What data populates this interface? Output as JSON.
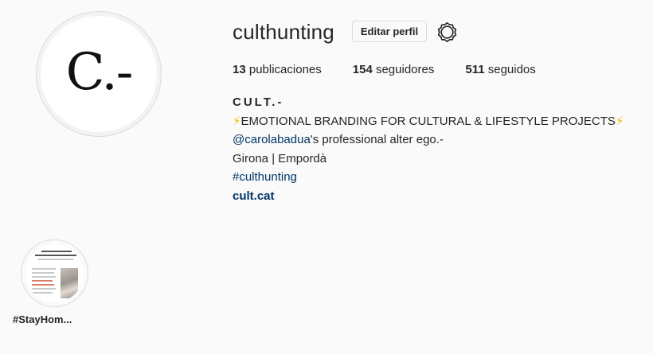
{
  "profile": {
    "avatar_text": "C.-",
    "username": "culthunting",
    "edit_button_label": "Editar perfil",
    "settings_icon": "gear-icon"
  },
  "stats": {
    "posts_count": "13",
    "posts_label": "publicaciones",
    "followers_count": "154",
    "followers_label": "seguidores",
    "following_count": "511",
    "following_label": "seguidos"
  },
  "bio": {
    "name": "CULT.-",
    "bolt": "⚡",
    "tagline": "EMOTIONAL BRANDING FOR CULTURAL & LIFESTYLE PROJECTS",
    "mention": "@carolabadua",
    "mention_suffix": "'s professional alter ego.-",
    "location": "Girona | Empordà",
    "hashtag": "#culthunting",
    "website": "cult.cat"
  },
  "highlights": [
    {
      "label": "#StayHom..."
    }
  ],
  "colors": {
    "background": "#fafafa",
    "text": "#262626",
    "link": "#003569",
    "border": "#dbdbdb",
    "bolt": "#f5b800"
  }
}
